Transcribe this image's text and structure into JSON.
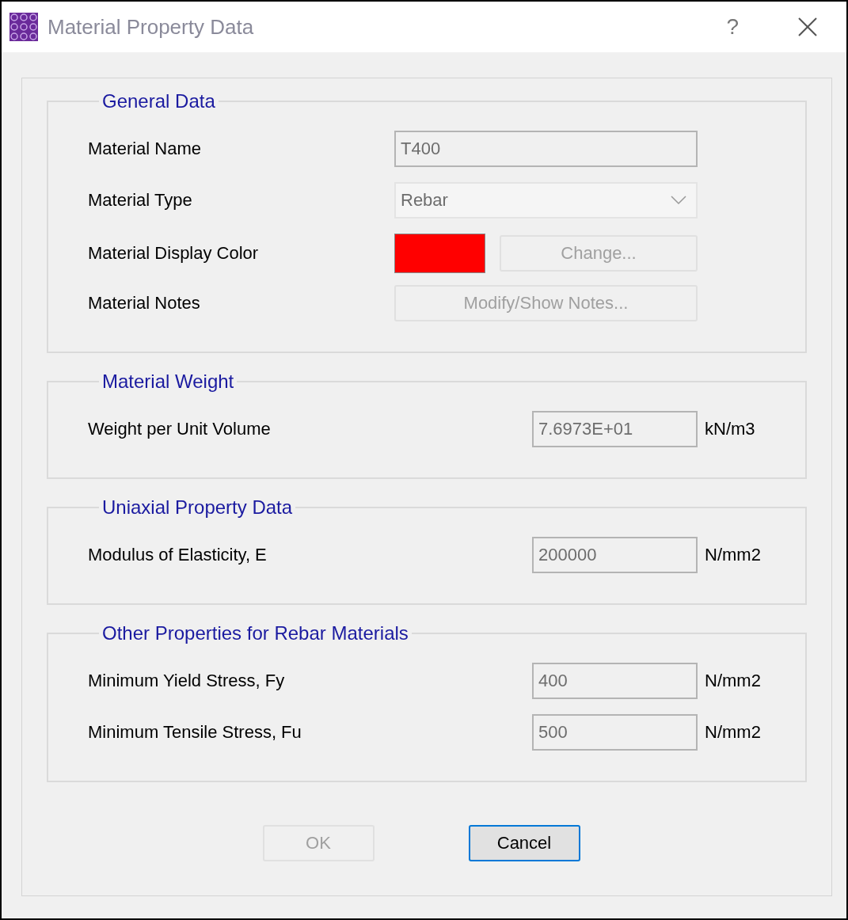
{
  "window": {
    "title": "Material Property Data",
    "help": "?"
  },
  "sections": [
    {
      "title": "General Data",
      "rows": [
        {
          "kind": "text",
          "label": "Material Name",
          "value": "T400",
          "disabled": true
        },
        {
          "kind": "dropdown",
          "label": "Material Type",
          "value": "Rebar",
          "disabled": true
        },
        {
          "kind": "color",
          "label": "Material Display Color",
          "color": "#ff0000",
          "button": {
            "label": "Change...",
            "disabled": true
          }
        },
        {
          "kind": "button",
          "label": "Material Notes",
          "button": {
            "label": "Modify/Show Notes...",
            "disabled": true
          }
        }
      ]
    },
    {
      "title": "Material Weight",
      "rows": [
        {
          "kind": "number",
          "label": "Weight per Unit Volume",
          "value": "7.6973E+01",
          "unit": "kN/m3",
          "disabled": true
        }
      ]
    },
    {
      "title": "Uniaxial Property Data",
      "rows": [
        {
          "kind": "number",
          "label": "Modulus of Elasticity,  E",
          "value": "200000",
          "unit": "N/mm2",
          "disabled": true
        }
      ]
    },
    {
      "title": "Other Properties for Rebar Materials",
      "rows": [
        {
          "kind": "number",
          "label": "Minimum Yield Stress, Fy",
          "value": "400",
          "unit": "N/mm2",
          "disabled": true
        },
        {
          "kind": "number",
          "label": "Minimum Tensile Stress, Fu",
          "value": "500",
          "unit": "N/mm2",
          "disabled": true
        }
      ]
    }
  ],
  "buttons": [
    {
      "label": "OK",
      "disabled": true,
      "default": false
    },
    {
      "label": "Cancel",
      "disabled": false,
      "default": true
    }
  ]
}
